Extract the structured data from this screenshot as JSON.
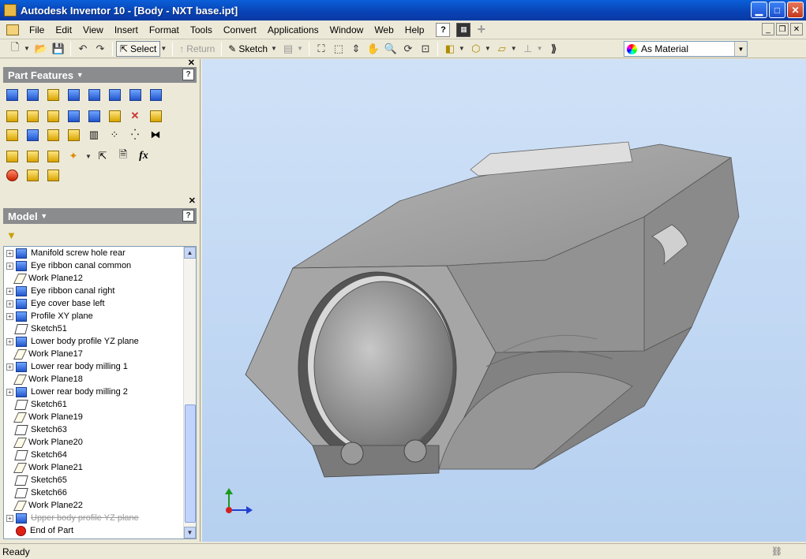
{
  "window": {
    "title": "Autodesk Inventor 10 - [Body - NXT base.ipt]"
  },
  "menu": {
    "items": [
      "File",
      "Edit",
      "View",
      "Insert",
      "Format",
      "Tools",
      "Convert",
      "Applications",
      "Window",
      "Web",
      "Help"
    ]
  },
  "toolbar": {
    "select_label": "Select",
    "return_label": "Return",
    "sketch_label": "Sketch",
    "style_value": "As Material"
  },
  "panels": {
    "features_title": "Part Features",
    "model_title": "Model"
  },
  "tree": {
    "items": [
      {
        "label": "Manifold screw hole rear",
        "icon": "extrude-feature-icon",
        "expandable": true
      },
      {
        "label": "Eye ribbon canal common",
        "icon": "extrude-feature-icon",
        "expandable": true
      },
      {
        "label": "Work Plane12",
        "icon": "work-plane-icon",
        "expandable": false
      },
      {
        "label": "Eye ribbon canal right",
        "icon": "extrude-feature-icon",
        "expandable": true
      },
      {
        "label": "Eye cover base left",
        "icon": "mirror-feature-icon",
        "expandable": true
      },
      {
        "label": "Profile XY plane",
        "icon": "extrude-feature-icon",
        "expandable": true
      },
      {
        "label": "Sketch51",
        "icon": "sketch-icon",
        "expandable": false
      },
      {
        "label": "Lower body profile YZ plane",
        "icon": "extrude-feature-icon",
        "expandable": true
      },
      {
        "label": "Work Plane17",
        "icon": "work-plane-icon",
        "expandable": false
      },
      {
        "label": "Lower rear body milling 1",
        "icon": "sweep-feature-icon",
        "expandable": true
      },
      {
        "label": "Work Plane18",
        "icon": "work-plane-icon",
        "expandable": false
      },
      {
        "label": "Lower rear body milling 2",
        "icon": "sweep-feature-icon",
        "expandable": true
      },
      {
        "label": "Sketch61",
        "icon": "sketch-icon",
        "expandable": false
      },
      {
        "label": "Work Plane19",
        "icon": "work-plane-icon",
        "expandable": false
      },
      {
        "label": "Sketch63",
        "icon": "sketch-icon",
        "expandable": false
      },
      {
        "label": "Work Plane20",
        "icon": "work-plane-icon",
        "expandable": false
      },
      {
        "label": "Sketch64",
        "icon": "sketch-icon",
        "expandable": false
      },
      {
        "label": "Work Plane21",
        "icon": "work-plane-icon",
        "expandable": false
      },
      {
        "label": "Sketch65",
        "icon": "sketch-icon",
        "expandable": false
      },
      {
        "label": "Sketch66",
        "icon": "sketch-icon",
        "expandable": false
      },
      {
        "label": "Work Plane22",
        "icon": "work-plane-icon",
        "expandable": false
      },
      {
        "label": "Upper body profile YZ plane",
        "icon": "extrude-feature-icon",
        "expandable": true,
        "suppressed": true
      },
      {
        "label": "End of Part",
        "icon": "end-of-part-icon",
        "expandable": false
      }
    ]
  },
  "status": {
    "text": "Ready"
  },
  "colors": {
    "titlebar": "#0842b5",
    "viewport_bg": "#c4daf4",
    "panel_header": "#8a8c8e",
    "part_body": "#9a9a9a"
  }
}
